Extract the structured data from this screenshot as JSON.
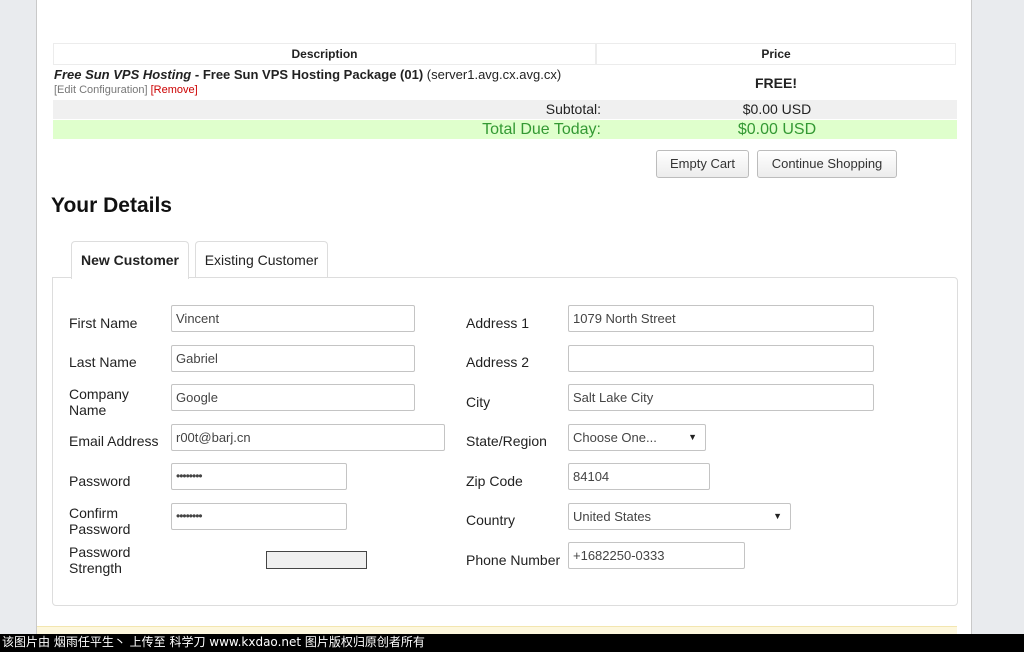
{
  "cart": {
    "col_description": "Description",
    "col_price": "Price",
    "product_group": "Free Sun VPS Hosting",
    "product_separator": " - ",
    "product_name": "Free Sun VPS Hosting Package (01)",
    "product_domain": " (server1.avg.cx.avg.cx)",
    "edit_link": "[Edit Configuration]",
    "remove_link": "[Remove]",
    "price": "FREE!",
    "subtotal_label": "Subtotal:",
    "subtotal_value": "$0.00 USD",
    "total_label": "Total Due Today:",
    "total_value": "$0.00 USD",
    "empty_cart": "Empty Cart",
    "continue_shopping": "Continue Shopping"
  },
  "details": {
    "heading": "Your Details",
    "tabs": [
      "New Customer",
      "Existing Customer"
    ],
    "fields": {
      "first_name": {
        "label": "First Name",
        "value": "Vincent"
      },
      "last_name": {
        "label": "Last Name",
        "value": "Gabriel"
      },
      "company": {
        "label1": "Company",
        "label2": "Name",
        "value": "Google"
      },
      "email": {
        "label": "Email Address",
        "value": "r00t@barj.cn"
      },
      "password": {
        "label": "Password",
        "value": "••••••••"
      },
      "confirm": {
        "label1": "Confirm",
        "label2": "Password",
        "value": "••••••••"
      },
      "strength": {
        "label1": "Password",
        "label2": "Strength"
      },
      "address1": {
        "label": "Address 1",
        "value": "1079 North Street"
      },
      "address2": {
        "label": "Address 2",
        "value": ""
      },
      "city": {
        "label": "City",
        "value": "Salt Lake City"
      },
      "state": {
        "label": "State/Region",
        "value": "Choose One..."
      },
      "zip": {
        "label": "Zip Code",
        "value": "84104"
      },
      "country": {
        "label": "Country",
        "value": "United States"
      },
      "phone": {
        "label": "Phone Number",
        "value": "+1682250-0333"
      }
    }
  },
  "footer": {
    "watermark": "该图片由 烟雨任平生丶 上传至 科学刀 www.kxdao.net 图片版权归原创者所有"
  },
  "colors": {
    "total_green": "#339933",
    "total_bg": "#dfffcc",
    "remove_red": "#cc0000"
  }
}
